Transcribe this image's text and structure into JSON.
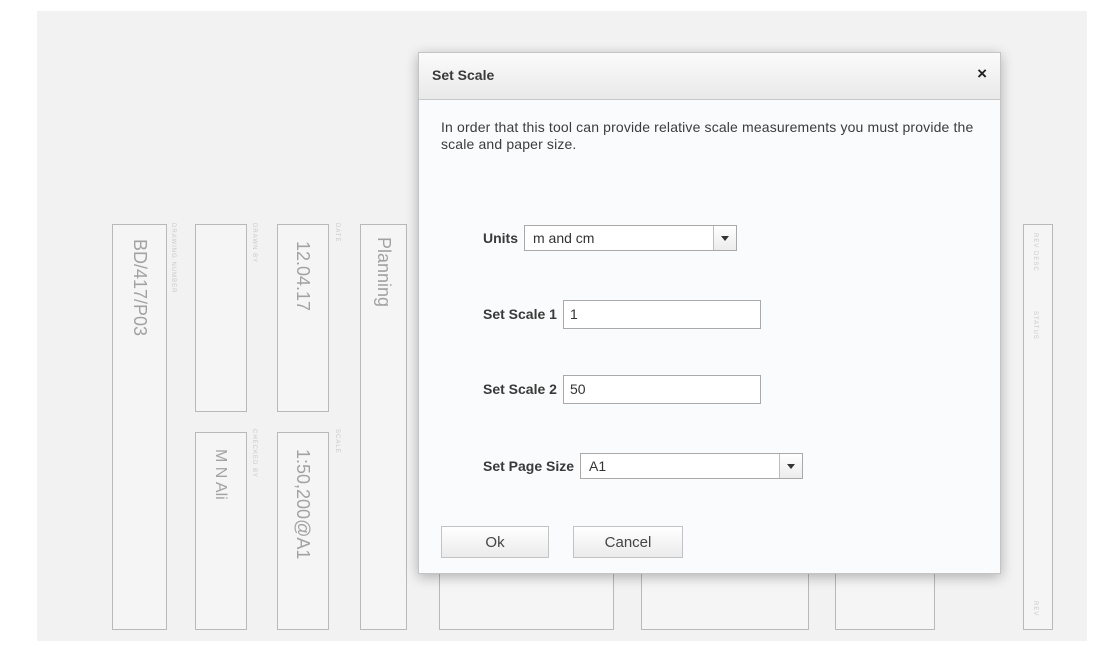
{
  "background": {
    "drawing_number": "BD/417/P03",
    "date_text": "12.04.17",
    "status_text": "Planning",
    "checked_by": "M N Ali",
    "scale_text": "1:50,200@A1",
    "labels": {
      "drawing_no": "DRAWING NUMBER",
      "drawn_by": "DRAWN BY",
      "date": "DATE",
      "checked_by": "CHECKED BY",
      "scale": "SCALE",
      "rev_desc": "REV DESC",
      "status": "STATUS",
      "rev": "REV"
    }
  },
  "dialog": {
    "title": "Set Scale",
    "close_symbol": "×",
    "description": "In order that this tool can provide relative scale measurements you must provide the scale and paper size.",
    "units": {
      "label": "Units",
      "value": "m and cm"
    },
    "scale1": {
      "label": "Set Scale 1",
      "value": "1"
    },
    "scale2": {
      "label": "Set Scale 2",
      "value": "50"
    },
    "page_size": {
      "label": "Set Page Size",
      "value": "A1"
    },
    "ok_label": "Ok",
    "cancel_label": "Cancel"
  },
  "colors": {
    "title_bar": "#e9e9e9",
    "dialog_body": "#fafbfc",
    "faded_text": "#a2a2a2"
  }
}
